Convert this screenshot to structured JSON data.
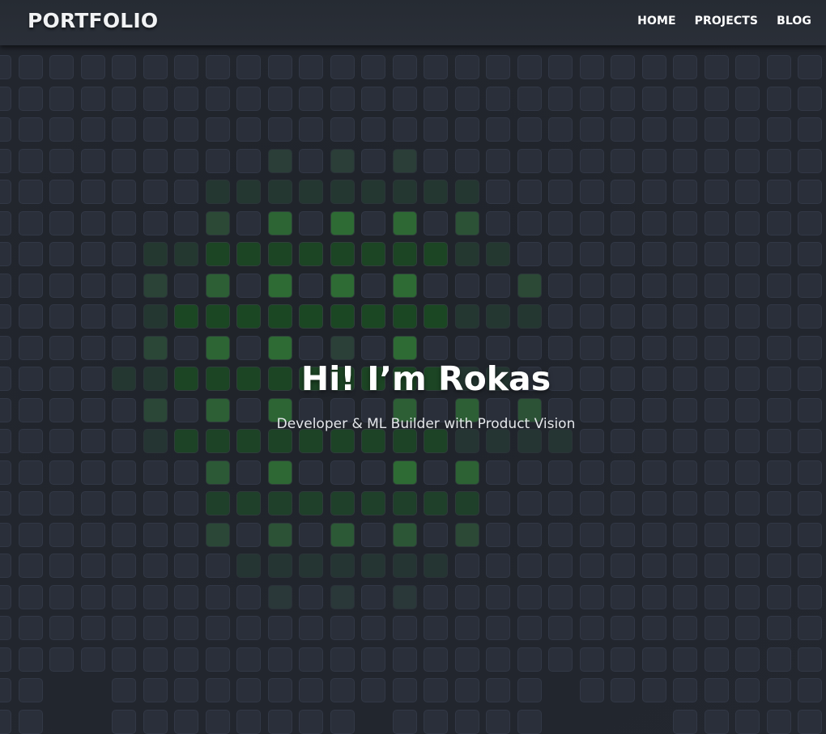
{
  "header": {
    "brand": "PORTFOLIO",
    "nav": [
      {
        "label": "HOME"
      },
      {
        "label": "PROJECTS"
      },
      {
        "label": "BLOG"
      }
    ]
  },
  "hero": {
    "title": "Hi! I’m Rokas",
    "subtitle": "Developer & ML Builder with Product Vision"
  },
  "theme": {
    "background": "#23272f",
    "tile": "#2a2f3a",
    "tile_border": "#323846",
    "accent_bright": "#2e6b34",
    "accent_dark": "#1b4723",
    "text": "#ffffff"
  },
  "background_pattern": {
    "icon": "hash-symbol-tile-grid"
  }
}
